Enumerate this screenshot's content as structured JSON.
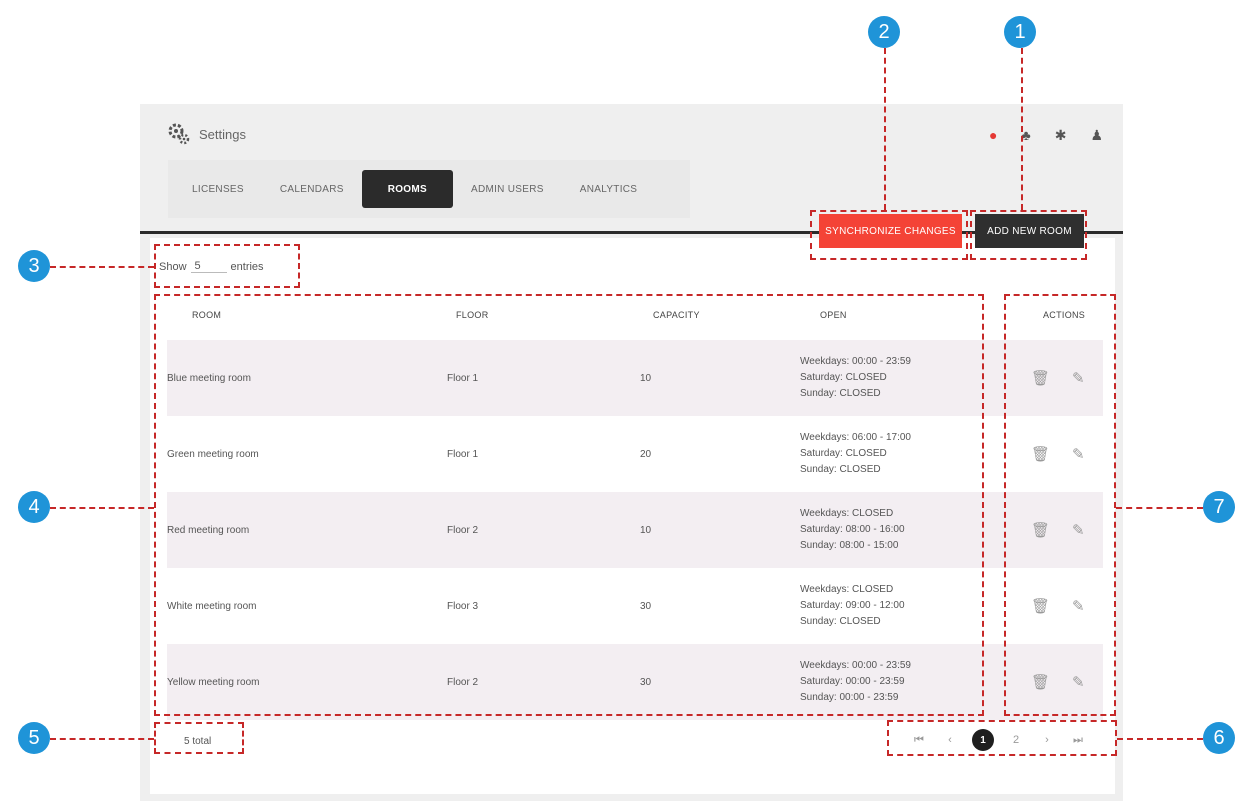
{
  "header": {
    "title": "Settings",
    "icons": [
      "gear-cog-icon",
      "alert-icon",
      "user-group-icon",
      "gear-icon",
      "user-icon"
    ]
  },
  "tabs": [
    {
      "label": "LICENSES",
      "active": false
    },
    {
      "label": "CALENDARS",
      "active": false
    },
    {
      "label": "ROOMS",
      "active": true
    },
    {
      "label": "ADMIN USERS",
      "active": false
    },
    {
      "label": "ANALYTICS",
      "active": false
    }
  ],
  "actions": {
    "sync_label": "SYNCHRONIZE CHANGES",
    "add_label": "ADD NEW ROOM"
  },
  "show_entries": {
    "prefix": "Show",
    "value": "5",
    "suffix": "entries"
  },
  "table": {
    "columns": [
      "ROOM",
      "FLOOR",
      "CAPACITY",
      "OPEN",
      "ACTIONS"
    ],
    "rows": [
      {
        "room": "Blue meeting room",
        "floor": "Floor 1",
        "capacity": "10",
        "open": [
          "Weekdays: 00:00 - 23:59",
          "Saturday: CLOSED",
          "Sunday: CLOSED"
        ]
      },
      {
        "room": "Green meeting room",
        "floor": "Floor 1",
        "capacity": "20",
        "open": [
          "Weekdays: 06:00 - 17:00",
          "Saturday: CLOSED",
          "Sunday: CLOSED"
        ]
      },
      {
        "room": "Red meeting room",
        "floor": "Floor 2",
        "capacity": "10",
        "open": [
          "Weekdays: CLOSED",
          "Saturday: 08:00 - 16:00",
          "Sunday: 08:00 - 15:00"
        ]
      },
      {
        "room": "White meeting room",
        "floor": "Floor 3",
        "capacity": "30",
        "open": [
          "Weekdays: CLOSED",
          "Saturday: 09:00 - 12:00",
          "Sunday: CLOSED"
        ]
      },
      {
        "room": "Yellow meeting room",
        "floor": "Floor 2",
        "capacity": "30",
        "open": [
          "Weekdays: 00:00 - 23:59",
          "Saturday: 00:00 - 23:59",
          "Sunday: 00:00 - 23:59"
        ]
      }
    ]
  },
  "footer": {
    "total": "5 total",
    "pager": {
      "first": "⏮",
      "prev": "‹",
      "pages": [
        "1",
        "2"
      ],
      "current": "1",
      "next": "›",
      "last": "⏭"
    }
  },
  "annotations": {
    "color": "#c62828",
    "marker_color": "#1f94d8",
    "markers": [
      "1",
      "2",
      "3",
      "4",
      "5",
      "6",
      "7"
    ]
  }
}
